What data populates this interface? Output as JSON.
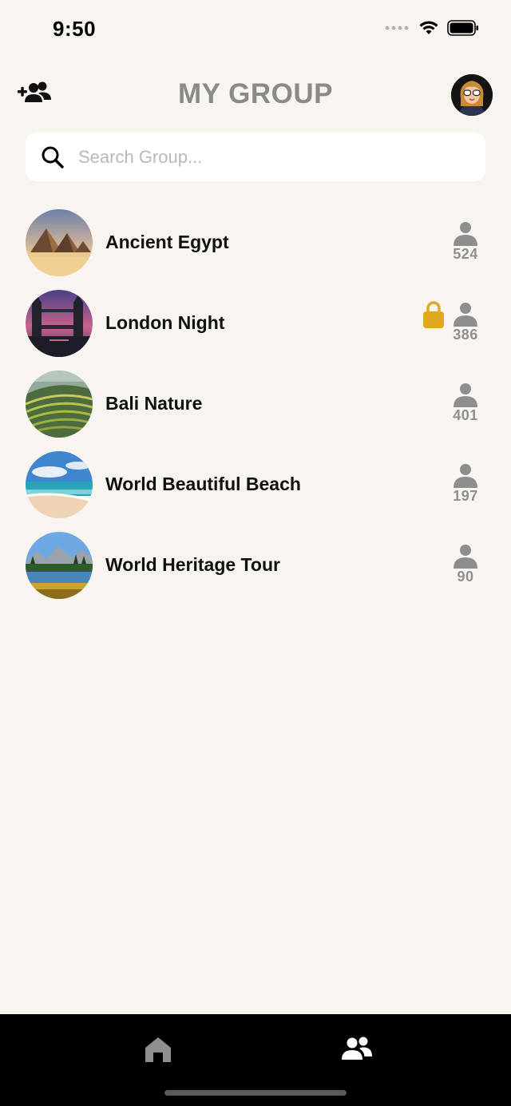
{
  "status_bar": {
    "time": "9:50"
  },
  "header": {
    "title": "MY GROUP"
  },
  "search": {
    "placeholder": "Search Group..."
  },
  "groups": [
    {
      "name": "Ancient Egypt",
      "members": "524",
      "locked": false,
      "image": "pyramids"
    },
    {
      "name": "London Night",
      "members": "386",
      "locked": true,
      "image": "tower-bridge"
    },
    {
      "name": "Bali Nature",
      "members": "401",
      "locked": false,
      "image": "rice-terraces"
    },
    {
      "name": "World Beautiful Beach",
      "members": "197",
      "locked": false,
      "image": "beach"
    },
    {
      "name": "World Heritage Tour",
      "members": "90",
      "locked": false,
      "image": "mountain-lake"
    }
  ],
  "colors": {
    "lock": "#e0a820",
    "title": "#8a8a8a",
    "background": "#f8f4f0"
  },
  "icons": [
    "add-group-icon",
    "search-icon",
    "person-icon",
    "lock-icon",
    "home-icon",
    "groups-icon"
  ]
}
